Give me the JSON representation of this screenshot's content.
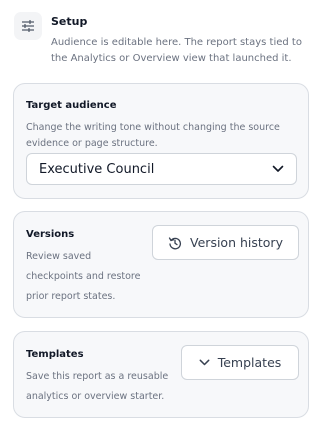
{
  "setup": {
    "icon": "sliders-icon",
    "title": "Setup",
    "description": "Audience is editable here. The report stays tied to the Analytics or Overview view that launched it."
  },
  "target_audience": {
    "title": "Target audience",
    "description": "Change the writing tone without changing the source evidence or page structure.",
    "selected": "Executive Council",
    "chevron_icon": "chevron-down-icon"
  },
  "versions": {
    "title": "Versions",
    "description_lines": [
      "Review saved",
      "checkpoints and restore",
      "prior report states."
    ],
    "button_label": "Version history",
    "button_icon": "history-icon"
  },
  "templates": {
    "title": "Templates",
    "description_lines": [
      "Save this report as a reusable",
      "analytics or overview starter."
    ],
    "button_label": "Templates",
    "button_icon": "chevron-down-icon"
  },
  "colors": {
    "card_background": "#f7f8fa",
    "card_border": "#d9dde3",
    "muted_text": "#6b7280",
    "heading_text": "#111827"
  }
}
